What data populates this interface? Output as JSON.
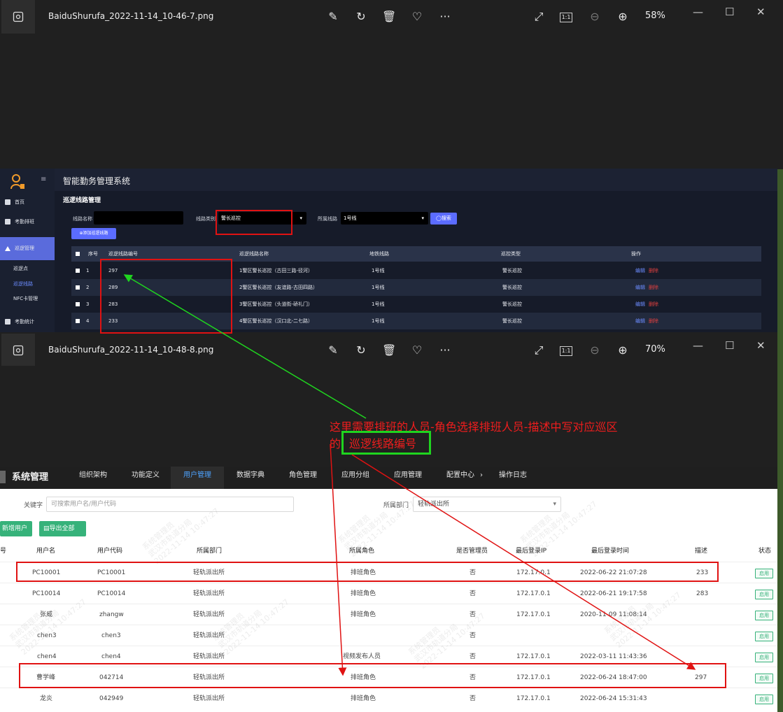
{
  "viewer1": {
    "filename": "BaiduShurufa_2022-11-14_10-46-7.png",
    "zoom": "58%",
    "actual_size": "1:1"
  },
  "viewer2": {
    "filename": "BaiduShurufa_2022-11-14_10-48-8.png",
    "zoom": "70%",
    "actual_size": "1:1"
  },
  "shot1": {
    "app_title": "智能勤务管理系统",
    "page_title": "巡逻线路管理",
    "sidebar": [
      {
        "label": "首页"
      },
      {
        "label": "考勤排班"
      },
      {
        "label": "巡逻管理"
      },
      {
        "label": "巡逻点"
      },
      {
        "label": "巡逻线路"
      },
      {
        "label": "NFC卡管理"
      },
      {
        "label": "考勤统计"
      }
    ],
    "filters": {
      "route_name_label": "线路名称",
      "route_type_label": "线路类别",
      "route_type_value": "警长巡控",
      "line_label": "所属线路",
      "line_value": "1号线",
      "search_button": "搜索",
      "add_button": "添加巡逻线路"
    },
    "columns": [
      "序号",
      "巡逻线路编号",
      "巡逻线路名称",
      "地铁线路",
      "巡控类型",
      "操作"
    ],
    "rows": [
      {
        "seq": "1",
        "code": "297",
        "name": "1警区警长巡控（古田三路-径河）",
        "line": "1号线",
        "type": "警长巡控",
        "edit": "编辑",
        "delete": "删除"
      },
      {
        "seq": "2",
        "code": "289",
        "name": "2警区警长巡控（友谊路-古田四路）",
        "line": "1号线",
        "type": "警长巡控",
        "edit": "编辑",
        "delete": "删除"
      },
      {
        "seq": "3",
        "code": "283",
        "name": "3警区警长巡控（头道街-硚礼门）",
        "line": "1号线",
        "type": "警长巡控",
        "edit": "编辑",
        "delete": "删除"
      },
      {
        "seq": "4",
        "code": "233",
        "name": "4警区警长巡控（汉口北-二七路）",
        "line": "1号线",
        "type": "警长巡控",
        "edit": "编辑",
        "delete": "删除"
      }
    ]
  },
  "annotation": {
    "line1": "这里需要排班的人员-角色选择排班人员-描述中写对应巡区",
    "line2_prefix": "的",
    "line2_box": "巡逻线路编号"
  },
  "shot2": {
    "app_title": "系统管理",
    "nav": [
      "组织架构",
      "功能定义",
      "用户管理",
      "数据字典",
      "角色管理",
      "应用分组",
      "应用管理",
      "配置中心",
      "操作日志"
    ],
    "nav_more": "›",
    "keyword_label": "关键字",
    "keyword_placeholder": "可搜索用户名/用户代码",
    "dept_label": "所属部门",
    "dept_value": "轻轨派出所",
    "add_user_button": "新增用户",
    "export_button": "导出全部",
    "columns": [
      "号",
      "用户名",
      "用户代码",
      "所属部门",
      "所属角色",
      "是否管理员",
      "最后登录IP",
      "最后登录时间",
      "描述",
      "状态"
    ],
    "rows": [
      {
        "username": "PC10001",
        "code": "PC10001",
        "dept": "轻轨派出所",
        "role": "排班角色",
        "admin": "否",
        "ip": "172.17.0.1",
        "time": "2022-06-22 21:07:28",
        "desc": "233",
        "status": "启用"
      },
      {
        "username": "PC10014",
        "code": "PC10014",
        "dept": "轻轨派出所",
        "role": "排班角色",
        "admin": "否",
        "ip": "172.17.0.1",
        "time": "2022-06-21 19:17:58",
        "desc": "283",
        "status": "启用"
      },
      {
        "username": "张威",
        "code": "zhangw",
        "dept": "轻轨派出所",
        "role": "排班角色",
        "admin": "否",
        "ip": "172.17.0.1",
        "time": "2020-11-09 11:08:14",
        "desc": "",
        "status": "启用"
      },
      {
        "username": "chen3",
        "code": "chen3",
        "dept": "轻轨派出所",
        "role": "",
        "admin": "否",
        "ip": "",
        "time": "",
        "desc": "",
        "status": "启用"
      },
      {
        "username": "chen4",
        "code": "chen4",
        "dept": "轻轨派出所",
        "role": "视频发布人员",
        "admin": "否",
        "ip": "172.17.0.1",
        "time": "2022-03-11 11:43:36",
        "desc": "",
        "status": "启用"
      },
      {
        "username": "曹学峰",
        "code": "042714",
        "dept": "轻轨派出所",
        "role": "排班角色",
        "admin": "否",
        "ip": "172.17.0.1",
        "time": "2022-06-24 18:47:00",
        "desc": "297",
        "status": "启用"
      },
      {
        "username": "龙炎",
        "code": "042949",
        "dept": "轻轨派出所",
        "role": "排班角色",
        "admin": "否",
        "ip": "172.17.0.1",
        "time": "2022-06-24 15:31:43",
        "desc": "",
        "status": "启用"
      }
    ],
    "watermark_line1": "系统管理员",
    "watermark_line2": "武汉市轨道分局",
    "watermark_line3": "2022-11-14 10:47:27"
  },
  "colors": {
    "annotation_red": "#e01212",
    "annotation_green": "#1fd41f",
    "accent_blue": "#5b6cff",
    "green_button": "#36b27a"
  }
}
